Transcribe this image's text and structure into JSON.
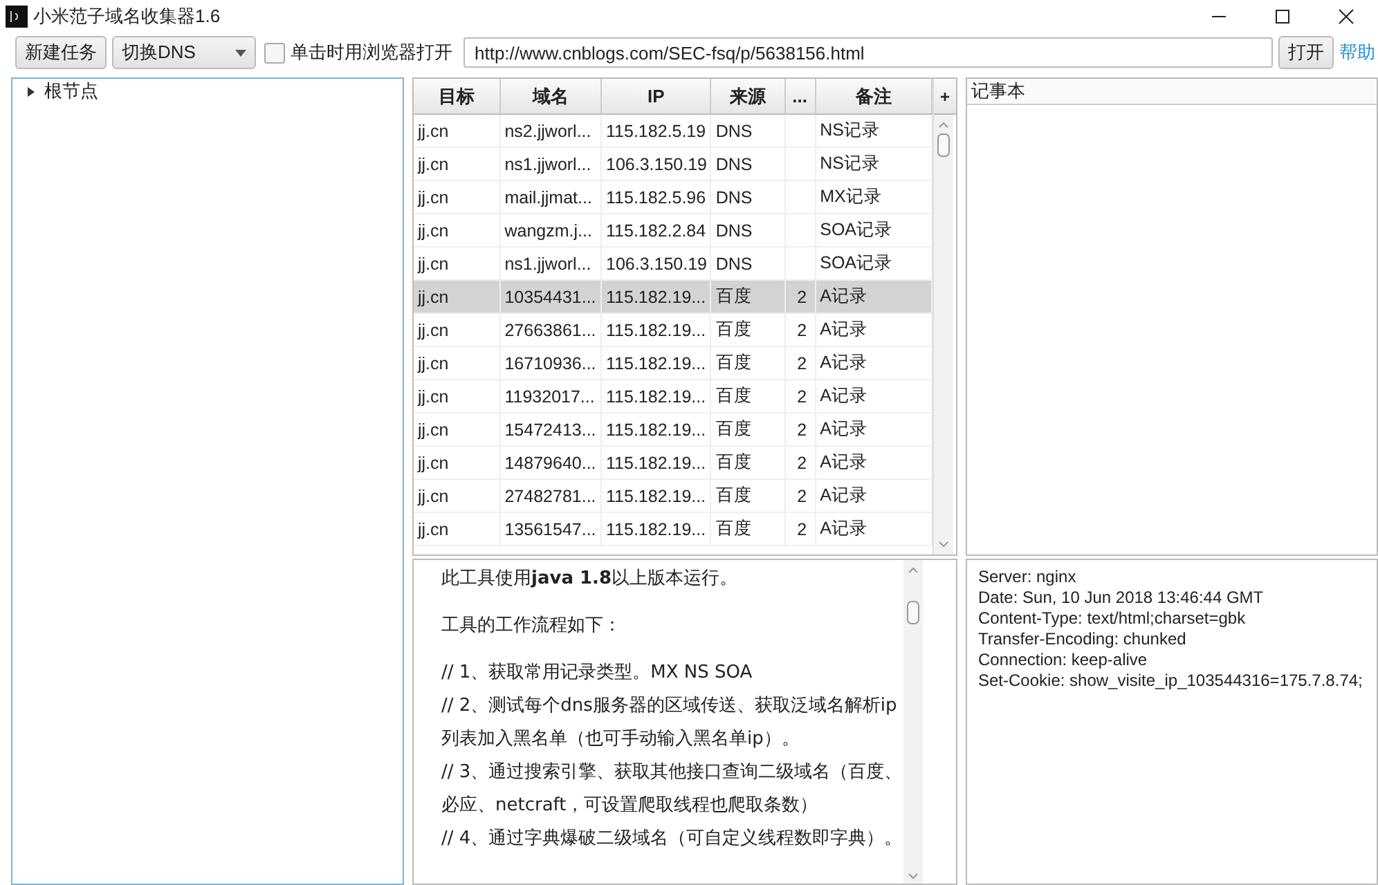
{
  "window": {
    "title": "小米范子域名收集器1.6"
  },
  "toolbar": {
    "new_task_button": "新建任务",
    "dns_dropdown": "切换DNS",
    "open_in_browser": {
      "label": "单击时用浏览器打开",
      "checked": false
    },
    "url": "http://www.cnblogs.com/SEC-fsq/p/5638156.html",
    "open_button": "打开",
    "help_link": "帮助"
  },
  "tree": {
    "items": [
      {
        "label": "根节点",
        "expanded": false
      }
    ]
  },
  "table": {
    "columns": [
      "目标",
      "域名",
      "IP",
      "来源",
      "...",
      "备注"
    ],
    "add_column": "+",
    "rows": [
      {
        "cells": [
          "jj.cn",
          "ns2.jjworl...",
          "115.182.5.19",
          "DNS",
          "",
          "NS记录"
        ],
        "selected": false
      },
      {
        "cells": [
          "jj.cn",
          "ns1.jjworl...",
          "106.3.150.19",
          "DNS",
          "",
          "NS记录"
        ],
        "selected": false
      },
      {
        "cells": [
          "jj.cn",
          "mail.jjmat...",
          "115.182.5.96",
          "DNS",
          "",
          "MX记录"
        ],
        "selected": false
      },
      {
        "cells": [
          "jj.cn",
          "wangzm.j...",
          "115.182.2.84",
          "DNS",
          "",
          "SOA记录"
        ],
        "selected": false
      },
      {
        "cells": [
          "jj.cn",
          "ns1.jjworl...",
          "106.3.150.19",
          "DNS",
          "",
          "SOA记录"
        ],
        "selected": false
      },
      {
        "cells": [
          "jj.cn",
          "10354431...",
          "115.182.19...",
          "百度",
          "2",
          "A记录"
        ],
        "selected": true
      },
      {
        "cells": [
          "jj.cn",
          "27663861...",
          "115.182.19...",
          "百度",
          "2",
          "A记录"
        ],
        "selected": false
      },
      {
        "cells": [
          "jj.cn",
          "16710936...",
          "115.182.19...",
          "百度",
          "2",
          "A记录"
        ],
        "selected": false
      },
      {
        "cells": [
          "jj.cn",
          "11932017...",
          "115.182.19...",
          "百度",
          "2",
          "A记录"
        ],
        "selected": false
      },
      {
        "cells": [
          "jj.cn",
          "15472413...",
          "115.182.19...",
          "百度",
          "2",
          "A记录"
        ],
        "selected": false
      },
      {
        "cells": [
          "jj.cn",
          "14879640...",
          "115.182.19...",
          "百度",
          "2",
          "A记录"
        ],
        "selected": false
      },
      {
        "cells": [
          "jj.cn",
          "27482781...",
          "115.182.19...",
          "百度",
          "2",
          "A记录"
        ],
        "selected": false
      },
      {
        "cells": [
          "jj.cn",
          "13561547...",
          "115.182.19...",
          "百度",
          "2",
          "A记录"
        ],
        "selected": false
      }
    ]
  },
  "notepad": {
    "title": "记事本"
  },
  "web_view": {
    "paragraphs": [
      "此工具使用**java 1.8**以上版本运行。",
      "工具的工作流程如下：",
      "// 1、获取常用记录类型。MX NS SOA",
      "// 2、测试每个dns服务器的区域传送、获取泛域名解析ip列表加入黑名单（也可手动输入黑名单ip）。",
      "// 3、通过搜索引擎、获取其他接口查询二级域名（百度、必应、netcraft，可设置爬取线程也爬取条数）",
      "// 4、通过字典爆破二级域名（可自定义线程数即字典）。"
    ]
  },
  "response_headers": {
    "lines": [
      "Server: nginx",
      "Date: Sun, 10 Jun 2018 13:46:44 GMT",
      "Content-Type: text/html;charset=gbk",
      "Transfer-Encoding: chunked",
      "Connection: keep-alive",
      "Set-Cookie: show_visite_ip_103544316=175.7.8.74;"
    ]
  }
}
